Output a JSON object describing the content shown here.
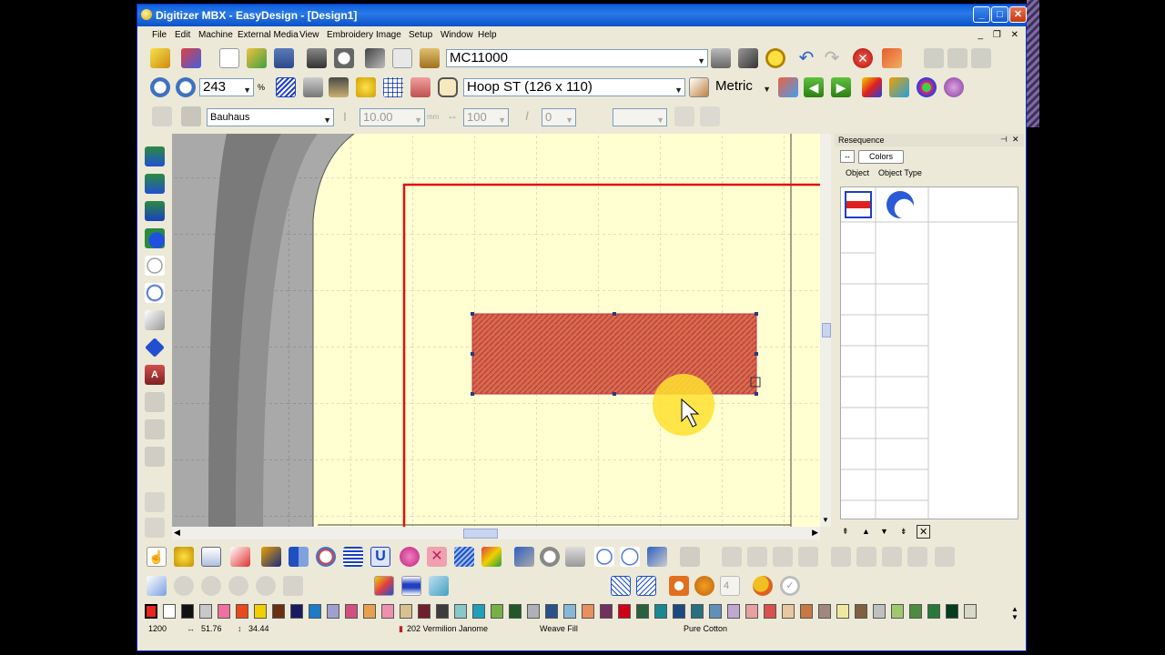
{
  "window": {
    "title": "Digitizer MBX - EasyDesign - [Design1]",
    "controls": {
      "minimize": "_",
      "maximize": "□",
      "close": "✕"
    },
    "mdi_controls": "_ ❐ ✕"
  },
  "menu": [
    "File",
    "Edit",
    "Machine",
    "External Media",
    "View",
    "Embroidery",
    "Image",
    "Setup",
    "Window",
    "Help"
  ],
  "toolbar1": {
    "machine_value": "MC11000"
  },
  "toolbar2": {
    "zoom_value": "243",
    "zoom_unit": "%",
    "hoop_value": "Hoop ST (126 x 110)",
    "units_value": "Metric"
  },
  "toolbar3": {
    "font_value": "Bauhaus",
    "height_value": "10.00",
    "height_unit": "mm",
    "width_value": "100",
    "italic_value": "0"
  },
  "resequence": {
    "title": "Resequence",
    "tab_colors": "Colors",
    "col_object": "Object",
    "col_object_type": "Object Type",
    "pin": "⊣",
    "close": "✕"
  },
  "palette_colors": [
    "#e8281e",
    "#ffffff",
    "#111111",
    "#c8c8c8",
    "#f070a0",
    "#e84a1c",
    "#f0d000",
    "#6a3010",
    "#1a1a60",
    "#1c7ac8",
    "#a0a0d0",
    "#d05080",
    "#e8a050",
    "#f090b0",
    "#d8c090",
    "#70202c",
    "#3c3c3c",
    "#88c8c8",
    "#20a0b8",
    "#78b048",
    "#205828",
    "#b0b0b8",
    "#2c5088",
    "#88b8d8",
    "#e89060",
    "#703060",
    "#d00018",
    "#286040",
    "#1a8890",
    "#1c4a80",
    "#287080",
    "#6090b8",
    "#c0a8d0",
    "#e8a0a0",
    "#d85050",
    "#e8c8a0",
    "#c87840",
    "#a08880",
    "#f0e8a0",
    "#806040",
    "#c0c0c0",
    "#a0c870",
    "#4c8c40",
    "#28783c",
    "#083c20",
    "#d8d8c8"
  ],
  "status": {
    "stitches": "1200",
    "width": "51.76",
    "height": "34.44",
    "thread": "202 Vermilion Janome",
    "fill": "Weave Fill",
    "brand": "Pure Cotton"
  },
  "colors": {
    "accent_title": "#0a5fd8",
    "hoop_bg": "#ffffd2",
    "stitch_block": "#d96a52",
    "hoop_line": "#e01010"
  }
}
